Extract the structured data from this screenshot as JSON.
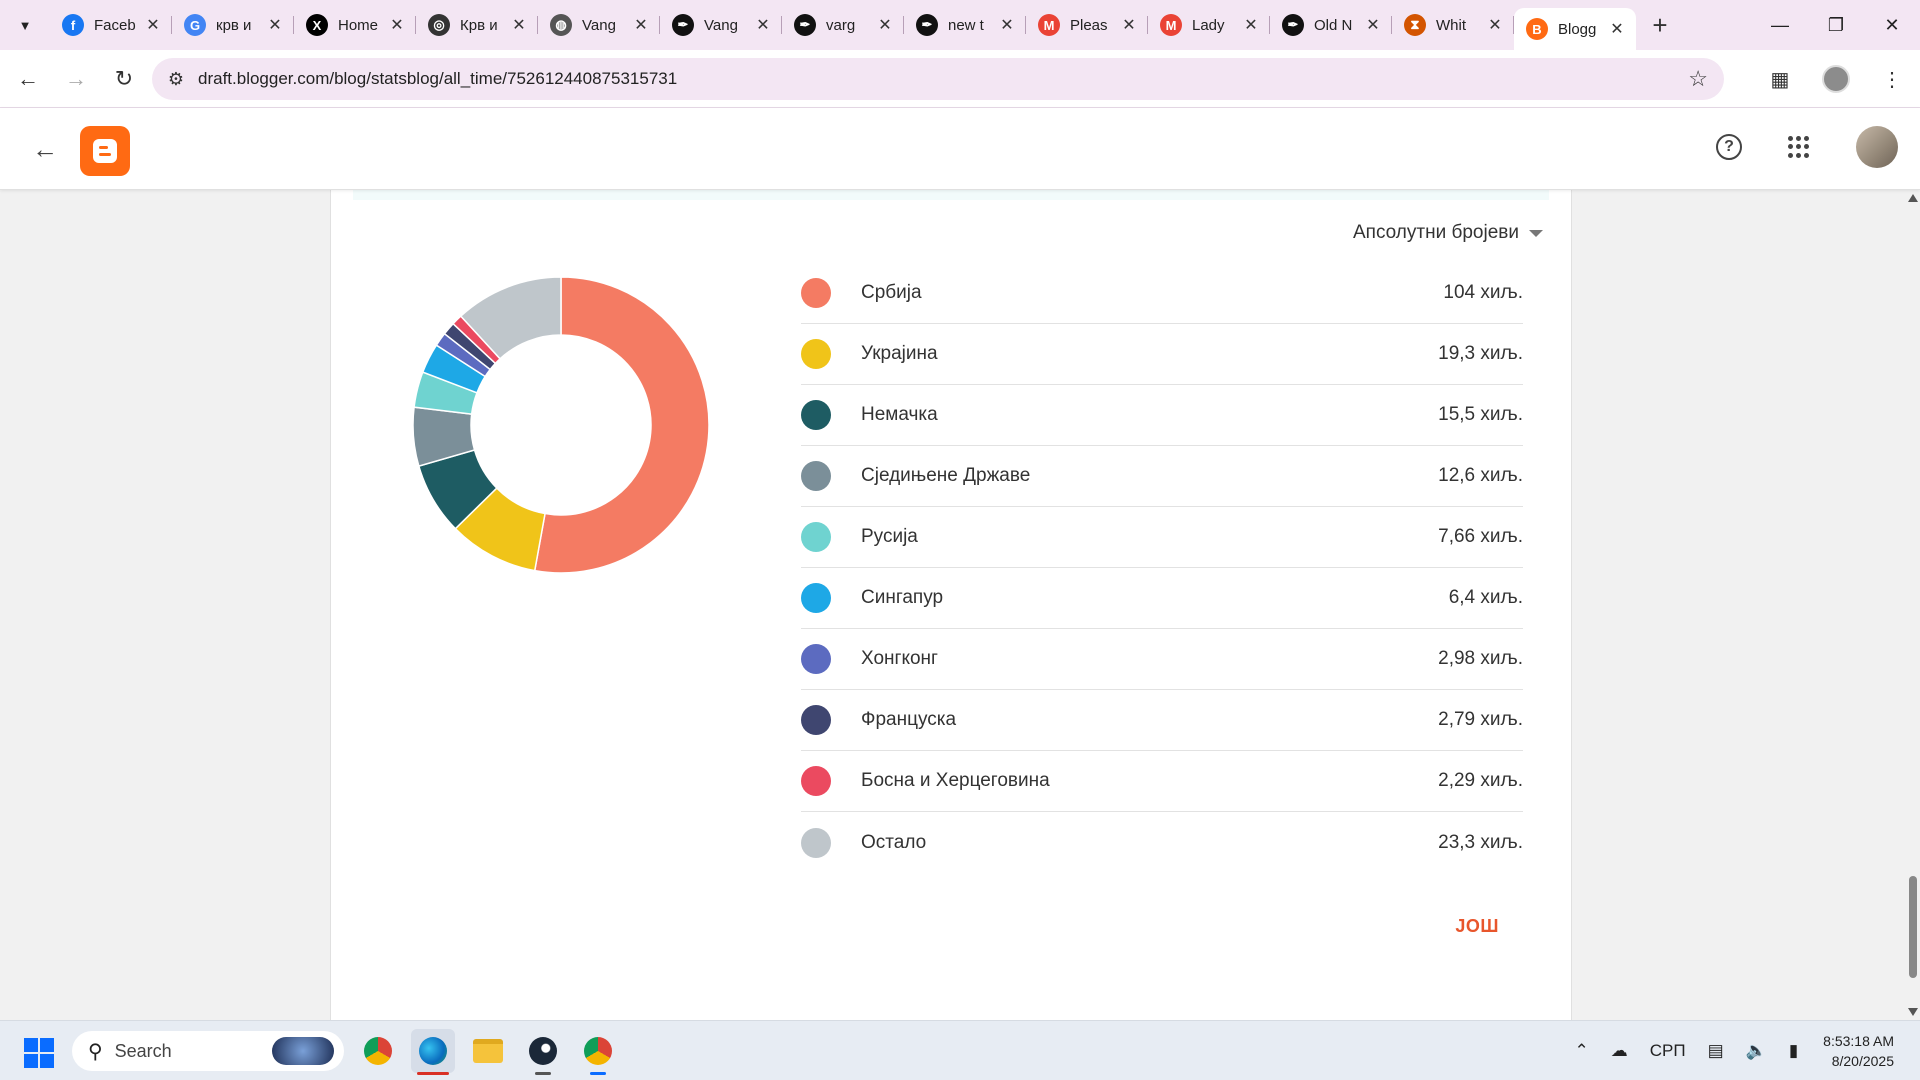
{
  "browser": {
    "tabs": [
      {
        "title": "Faceb",
        "icon": "facebook-icon",
        "color": "#1877f2",
        "glyph": "f"
      },
      {
        "title": "крв и",
        "icon": "google-icon",
        "color": "#4285f4",
        "glyph": "G"
      },
      {
        "title": "Home",
        "icon": "x-icon",
        "color": "#000000",
        "glyph": "X"
      },
      {
        "title": "Крв и",
        "icon": "site-icon",
        "color": "#333333",
        "glyph": "◎"
      },
      {
        "title": "Vang",
        "icon": "globe-icon",
        "color": "#555555",
        "glyph": "◍"
      },
      {
        "title": "Vang",
        "icon": "quill-icon",
        "color": "#111111",
        "glyph": "✒"
      },
      {
        "title": "varg",
        "icon": "quill-icon",
        "color": "#111111",
        "glyph": "✒"
      },
      {
        "title": "new t",
        "icon": "quill-icon",
        "color": "#111111",
        "glyph": "✒"
      },
      {
        "title": "Pleas",
        "icon": "gmail-icon",
        "color": "#ea4335",
        "glyph": "M"
      },
      {
        "title": "Lady",
        "icon": "gmail-icon",
        "color": "#ea4335",
        "glyph": "M"
      },
      {
        "title": "Old N",
        "icon": "quill-icon",
        "color": "#111111",
        "glyph": "✒"
      },
      {
        "title": "Whit",
        "icon": "hourglass-icon",
        "color": "#d35400",
        "glyph": "⧗"
      },
      {
        "title": "Blogg",
        "icon": "blogger-icon",
        "color": "#ff6a13",
        "glyph": "B"
      }
    ],
    "url": "draft.blogger.com/blog/statsblog/all_time/752612440875315731"
  },
  "stats": {
    "metric_select": "Апсолутни бројеви",
    "more_label": "ЈОШ",
    "legend": [
      {
        "name": "Србија",
        "value": "104 хиљ."
      },
      {
        "name": "Украјина",
        "value": "19,3 хиљ."
      },
      {
        "name": "Немачка",
        "value": "15,5 хиљ."
      },
      {
        "name": "Сједињене Државе",
        "value": "12,6 хиљ."
      },
      {
        "name": "Русија",
        "value": "7,66 хиљ."
      },
      {
        "name": "Сингапур",
        "value": "6,4 хиљ."
      },
      {
        "name": "Хонгконг",
        "value": "2,98 хиљ."
      },
      {
        "name": "Француска",
        "value": "2,79 хиљ."
      },
      {
        "name": "Босна и Херцеговина",
        "value": "2,29 хиљ."
      },
      {
        "name": "Остало",
        "value": "23,3 хиљ."
      }
    ]
  },
  "chart_data": {
    "type": "pie",
    "categories": [
      "Србија",
      "Украјина",
      "Немачка",
      "Сједињене Државе",
      "Русија",
      "Сингапур",
      "Хонгконг",
      "Француска",
      "Босна и Херцеговина",
      "Остало"
    ],
    "values": [
      104000,
      19300,
      15500,
      12600,
      7660,
      6400,
      2980,
      2790,
      2290,
      23300
    ],
    "colors": [
      "#f47b63",
      "#f0c419",
      "#1e5c63",
      "#7b8f99",
      "#6fd3d0",
      "#1ea8e6",
      "#5c6bc0",
      "#3f4670",
      "#eb4a60",
      "#bfc6cb"
    ],
    "donut": true
  },
  "taskbar": {
    "search_label": "Search",
    "language": "СРП",
    "time": "8:53:18 AM",
    "date": "8/20/2025"
  }
}
